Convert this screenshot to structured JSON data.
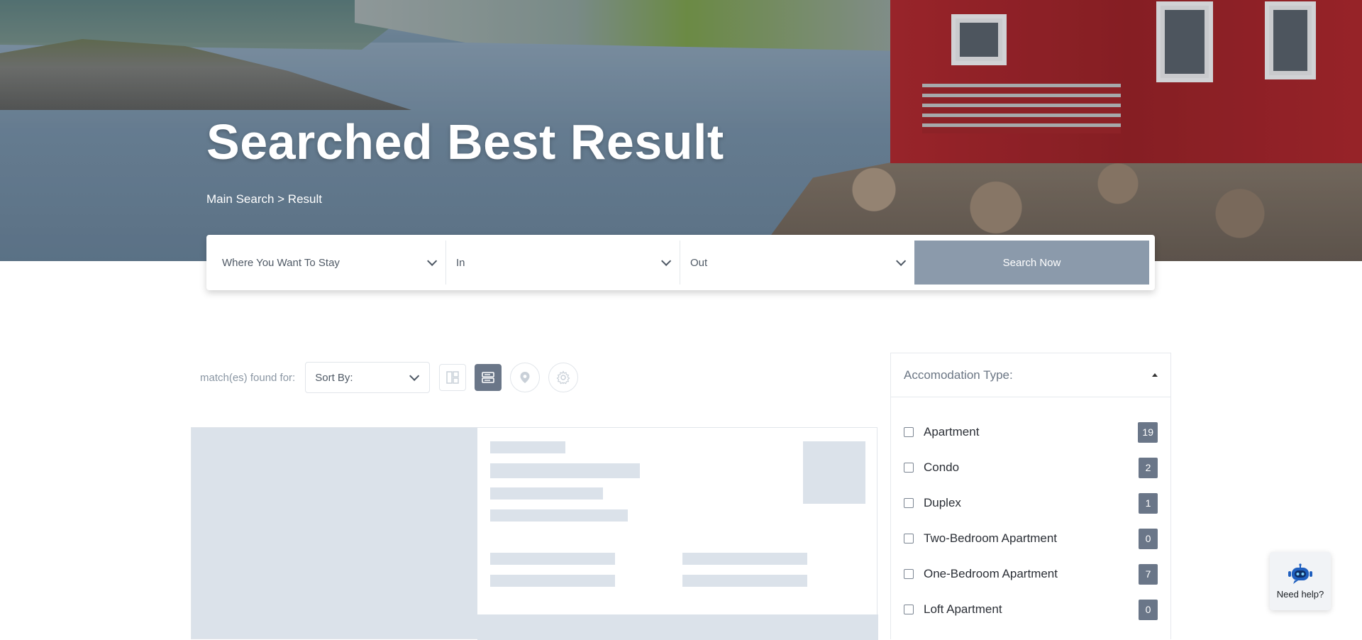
{
  "hero": {
    "title": "Searched Best Result",
    "breadcrumb": "Main Search > Result"
  },
  "search": {
    "destination_placeholder": "Where You Want To Stay",
    "checkin_placeholder": "In",
    "checkout_placeholder": "Out",
    "button_label": "Search Now"
  },
  "toolbar": {
    "match_label": "match(es) found for:",
    "sort_label": "Sort By:",
    "view_icons": [
      "grid-view-icon",
      "list-view-icon",
      "map-pin-icon",
      "settings-icon"
    ],
    "active_view": "list-view-icon"
  },
  "filter": {
    "title": "Accomodation Type:",
    "items": [
      {
        "label": "Apartment",
        "count": "19"
      },
      {
        "label": "Condo",
        "count": "2"
      },
      {
        "label": "Duplex",
        "count": "1"
      },
      {
        "label": "Two-Bedroom Apartment",
        "count": "0"
      },
      {
        "label": "One-Bedroom Apartment",
        "count": "7"
      },
      {
        "label": "Loft Apartment",
        "count": "0"
      }
    ]
  },
  "help": {
    "label": "Need help?",
    "icon": "chatbot-icon"
  },
  "colors": {
    "accent": "#6a7688",
    "search_button": "#8b9aab",
    "skeleton": "#dbe2ea",
    "hero_house": "#b5262a"
  }
}
